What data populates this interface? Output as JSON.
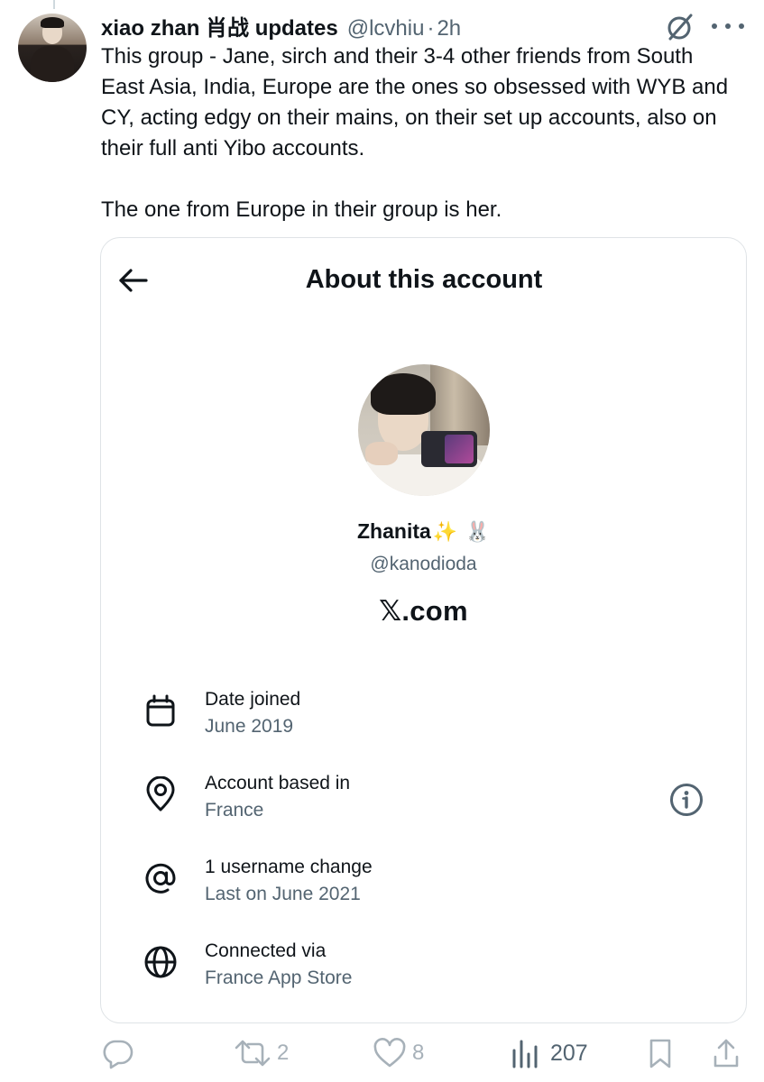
{
  "tweet": {
    "author": {
      "display_name": "xiao zhan 肖战 updates",
      "handle": "@lcvhiu",
      "separator": "·",
      "time": "2h"
    },
    "text_paragraphs": [
      "This group - Jane, sirch and their 3-4 other friends from South East Asia, India, Europe are the ones so obsessed with WYB and CY, acting edgy on their mains, on their set up accounts, also on their full anti Yibo accounts.",
      "The one from Europe in their group is her."
    ],
    "icons": {
      "grok": "grok-icon",
      "more": "more-options-icon"
    }
  },
  "embedded_screenshot": {
    "title": "About this account",
    "profile": {
      "name": "Zhanita",
      "name_emojis": [
        "✨",
        "🐰"
      ],
      "username": "@kanodioda",
      "site": "𝕏.com"
    },
    "rows": [
      {
        "icon": "calendar-icon",
        "label": "Date joined",
        "value": "June 2019"
      },
      {
        "icon": "location-pin-icon",
        "label": "Account based in",
        "value": "France"
      },
      {
        "icon": "at-sign-icon",
        "label": "1 username change",
        "value": "Last on June 2021"
      },
      {
        "icon": "globe-icon",
        "label": "Connected via",
        "value": "France App Store"
      }
    ]
  },
  "actions": {
    "reply": {
      "icon": "reply-icon",
      "count": ""
    },
    "retweet": {
      "icon": "retweet-icon",
      "count": "2"
    },
    "like": {
      "icon": "heart-icon",
      "count": "8"
    },
    "views": {
      "icon": "views-icon",
      "count": "207"
    },
    "bookmark": {
      "icon": "bookmark-icon"
    },
    "share": {
      "icon": "share-icon"
    }
  },
  "colors": {
    "text_primary": "#0f1419",
    "text_secondary": "#536471",
    "action_muted": "#a7b1b9",
    "border": "#dfe3e6"
  }
}
